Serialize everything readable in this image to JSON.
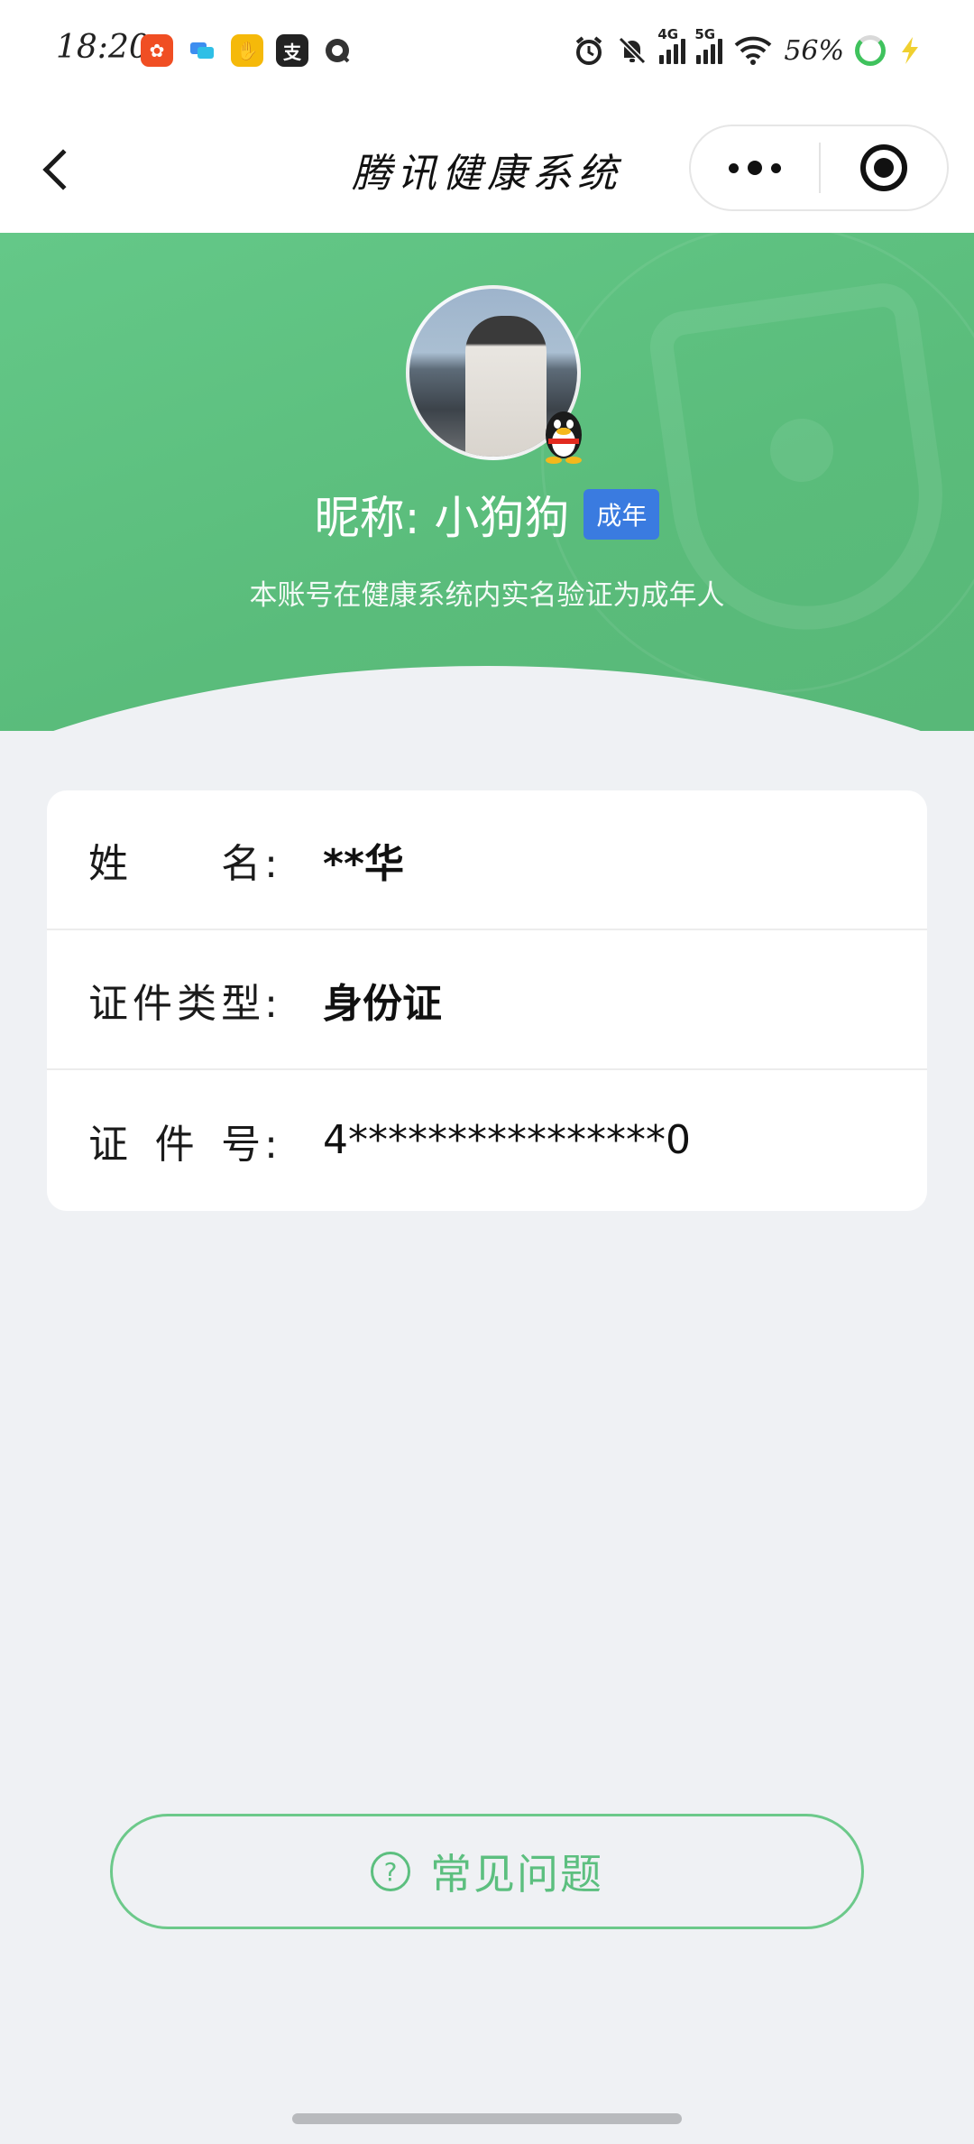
{
  "status_bar": {
    "time": "18:20",
    "app_icons": [
      {
        "name": "kuaishou-icon",
        "color": "#f04e23"
      },
      {
        "name": "chat-bubble-icon",
        "color": "#3d8ef0"
      },
      {
        "name": "yellow-app-icon",
        "color": "#f5b90a"
      },
      {
        "name": "alipay-icon",
        "color": "#222222"
      },
      {
        "name": "browser-icon",
        "color": "#333333"
      }
    ],
    "network_4g": "4G",
    "network_5g": "5G",
    "battery": "56%"
  },
  "nav": {
    "title": "腾讯健康系统"
  },
  "profile": {
    "nickname": "昵称: 小狗狗",
    "badge": "成年",
    "verify_text": "本账号在健康系统内实名验证为成年人"
  },
  "info": {
    "rows": [
      {
        "label_chars": [
          "姓",
          "名"
        ],
        "value": "**华"
      },
      {
        "label_chars": [
          "证",
          "件",
          "类",
          "型"
        ],
        "value": "身份证"
      },
      {
        "label_chars": [
          "证",
          "件",
          "号"
        ],
        "value": "4****************0"
      }
    ],
    "colon": ":"
  },
  "faq": {
    "icon": "?",
    "label": "常见问题"
  },
  "colors": {
    "brand_green": "#5abc7b",
    "badge_blue": "#3a7be0",
    "background": "#eff1f4"
  }
}
